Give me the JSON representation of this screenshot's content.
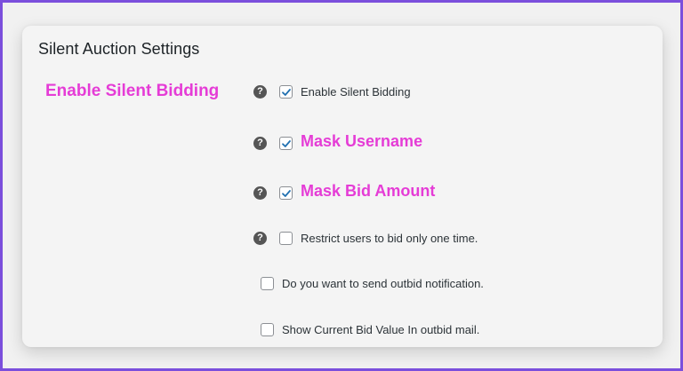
{
  "card": {
    "title": "Silent Auction Settings",
    "section_label": "Enable Silent Bidding"
  },
  "options": [
    {
      "label": "Enable Silent Bidding",
      "checked": true,
      "help": "?",
      "emphasized": false
    },
    {
      "label": "Mask Username",
      "checked": true,
      "help": "?",
      "emphasized": true
    },
    {
      "label": "Mask Bid Amount",
      "checked": true,
      "help": "?",
      "emphasized": true
    },
    {
      "label": "Restrict users to bid only one time.",
      "checked": false,
      "help": "?",
      "emphasized": false
    },
    {
      "label": "Do you want to send outbid notification.",
      "checked": false,
      "help": null,
      "emphasized": false
    },
    {
      "label": "Show Current Bid Value In outbid mail.",
      "checked": false,
      "help": null,
      "emphasized": false
    }
  ],
  "colors": {
    "border_frame": "#7b4fdc",
    "highlight": "#e53cd6",
    "checkmark": "#2271b1"
  }
}
